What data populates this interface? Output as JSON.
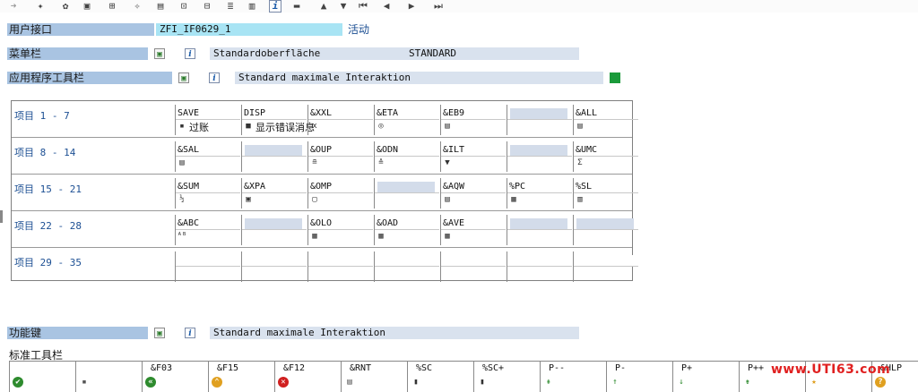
{
  "toolbar": {
    "icons": [
      "arrow-right-icon",
      "glasses-icon",
      "object-icon",
      "clipboard-icon",
      "hierarchy-icon",
      "wand-icon",
      "window-icon",
      "node-icon",
      "tree-icon",
      "stack-icon",
      "screen-icon",
      "info-icon",
      "hat-icon",
      "triangle-up-icon",
      "triangle-down-icon",
      "first-page-icon",
      "previous-icon",
      "next-icon",
      "last-page-icon"
    ],
    "info_glyph": "i"
  },
  "interface": {
    "label": "用户接口",
    "value": "ZFI_IF0629_1",
    "status": "活动"
  },
  "menu_bar": {
    "label": "菜单栏",
    "text": "Standardoberfläche",
    "code": "STANDARD"
  },
  "app_toolbar": {
    "label": "应用程序工具栏",
    "text": "Standard maximale Interaktion"
  },
  "grid": {
    "rows": [
      {
        "label": "项目  1 - 7",
        "cells": [
          {
            "code": "SAVE",
            "text": "过账",
            "icon": "save-icon",
            "glyph": "▪"
          },
          {
            "code": "DISP",
            "text": "显示错误消息",
            "icon": "error-log-icon",
            "glyph": "■"
          },
          {
            "code": "&XXL",
            "text": "",
            "icon": "xxl-icon",
            "glyph": "x"
          },
          {
            "code": "&ETA",
            "text": "",
            "icon": "detail-icon",
            "glyph": "◎"
          },
          {
            "code": "&EB9",
            "text": "",
            "icon": "chart-icon",
            "glyph": "▤"
          },
          {
            "code": "",
            "text": "",
            "icon": "",
            "glyph": ""
          },
          {
            "code": "&ALL",
            "text": "",
            "icon": "select-all-icon",
            "glyph": "▤"
          }
        ]
      },
      {
        "label": "项目  8 - 14",
        "cells": [
          {
            "code": "&SAL",
            "text": "",
            "icon": "deselect-icon",
            "glyph": "▤"
          },
          {
            "code": "",
            "text": "",
            "icon": "",
            "glyph": ""
          },
          {
            "code": "&OUP",
            "text": "",
            "icon": "sort-asc-icon",
            "glyph": "≘"
          },
          {
            "code": "&ODN",
            "text": "",
            "icon": "sort-desc-icon",
            "glyph": "≙"
          },
          {
            "code": "&ILT",
            "text": "",
            "icon": "filter-icon",
            "glyph": "▼"
          },
          {
            "code": "",
            "text": "",
            "icon": "",
            "glyph": ""
          },
          {
            "code": "&UMC",
            "text": "",
            "icon": "sum-icon",
            "glyph": "Σ"
          }
        ]
      },
      {
        "label": "项目 15 - 21",
        "cells": [
          {
            "code": "&SUM",
            "text": "",
            "icon": "subtotal-icon",
            "glyph": "½"
          },
          {
            "code": "&XPA",
            "text": "",
            "icon": "expand-icon",
            "glyph": "▣"
          },
          {
            "code": "&OMP",
            "text": "",
            "icon": "collapse-icon",
            "glyph": "▢"
          },
          {
            "code": "",
            "text": "",
            "icon": "",
            "glyph": ""
          },
          {
            "code": "&AQW",
            "text": "",
            "icon": "word-icon",
            "glyph": "▤"
          },
          {
            "code": "%PC",
            "text": "",
            "icon": "export-icon",
            "glyph": "▦"
          },
          {
            "code": "%SL",
            "text": "",
            "icon": "mail-icon",
            "glyph": "▥"
          }
        ]
      },
      {
        "label": "项目 22 - 28",
        "cells": [
          {
            "code": "&ABC",
            "text": "",
            "icon": "abc-icon",
            "glyph": "ᴬᴮ"
          },
          {
            "code": "",
            "text": "",
            "icon": "",
            "glyph": ""
          },
          {
            "code": "&OLO",
            "text": "",
            "icon": "layout-icon",
            "glyph": "▦"
          },
          {
            "code": "&OAD",
            "text": "",
            "icon": "layout-choose-icon",
            "glyph": "▦"
          },
          {
            "code": "&AVE",
            "text": "",
            "icon": "layout-save-icon",
            "glyph": "▦"
          },
          {
            "code": "",
            "text": "",
            "icon": "",
            "glyph": ""
          },
          {
            "code": "",
            "text": "",
            "icon": "",
            "glyph": ""
          }
        ]
      },
      {
        "label": "项目 29 - 35",
        "cells": [
          {
            "code": "",
            "text": "",
            "icon": "",
            "glyph": ""
          },
          {
            "code": "",
            "text": "",
            "icon": "",
            "glyph": ""
          },
          {
            "code": "",
            "text": "",
            "icon": "",
            "glyph": ""
          },
          {
            "code": "",
            "text": "",
            "icon": "",
            "glyph": ""
          },
          {
            "code": "",
            "text": "",
            "icon": "",
            "glyph": ""
          },
          {
            "code": "",
            "text": "",
            "icon": "",
            "glyph": ""
          },
          {
            "code": "",
            "text": "",
            "icon": "",
            "glyph": ""
          }
        ]
      }
    ]
  },
  "function_keys": {
    "label": "功能键",
    "text": "Standard maximale Interaktion"
  },
  "std_toolbar": {
    "label": "标准工具栏",
    "items": [
      {
        "code": "",
        "icon": "check-icon",
        "glyph": "✔",
        "color": "#2e8b2e"
      },
      {
        "code": "",
        "icon": "save-icon",
        "glyph": "▪",
        "color": "#555555"
      },
      {
        "code": "&F03",
        "icon": "back-icon",
        "glyph": "«",
        "color": "#2e8b2e"
      },
      {
        "code": "&F15",
        "icon": "exit-icon",
        "glyph": "⌃",
        "color": "#e0a020"
      },
      {
        "code": "&F12",
        "icon": "cancel-icon",
        "glyph": "✕",
        "color": "#d02020"
      },
      {
        "code": "&RNT",
        "icon": "print-icon",
        "glyph": "▤",
        "color": "#555555"
      },
      {
        "code": "%SC",
        "icon": "find-icon",
        "glyph": "▮",
        "color": "#333333"
      },
      {
        "code": "%SC+",
        "icon": "find-next-icon",
        "glyph": "▮",
        "color": "#333333"
      },
      {
        "code": "P--",
        "icon": "first-page-icon",
        "glyph": "⇞",
        "color": "#2e8b2e"
      },
      {
        "code": "P-",
        "icon": "prev-page-icon",
        "glyph": "↑",
        "color": "#2e8b2e"
      },
      {
        "code": "P+",
        "icon": "next-page-icon",
        "glyph": "↓",
        "color": "#2e8b2e"
      },
      {
        "code": "P++",
        "icon": "last-page-icon",
        "glyph": "⇟",
        "color": "#2e8b2e"
      },
      {
        "code": "",
        "icon": "bookmark-icon",
        "glyph": "★",
        "color": "#e0a020"
      },
      {
        "code": "&HLP",
        "icon": "help-icon",
        "glyph": "?",
        "color": "#e0a020"
      }
    ]
  },
  "watermark": "www.UTI63.com",
  "colors": {
    "label_bar": "#a9c4e2",
    "field": "#d9e2ee",
    "interface_field": "#a8e4f4",
    "status_green": "#1a9a3a",
    "link_blue": "#1c4f93"
  }
}
